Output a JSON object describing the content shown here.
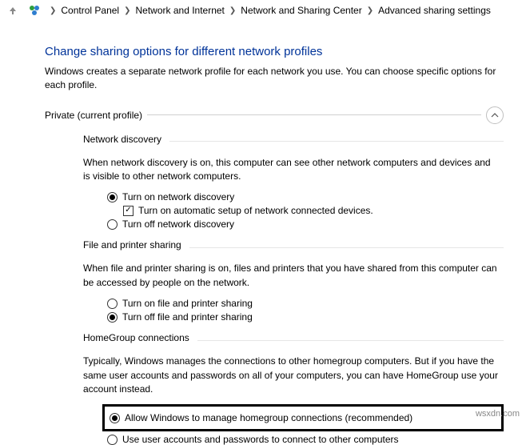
{
  "breadcrumb": {
    "items": [
      "Control Panel",
      "Network and Internet",
      "Network and Sharing Center",
      "Advanced sharing settings"
    ]
  },
  "title": "Change sharing options for different network profiles",
  "subtitle": "Windows creates a separate network profile for each network you use. You can choose specific options for each profile.",
  "profile_label": "Private (current profile)",
  "sections": {
    "network_discovery": {
      "title": "Network discovery",
      "desc": "When network discovery is on, this computer can see other network computers and devices and is visible to other network computers.",
      "opt_on": "Turn on network discovery",
      "opt_auto": "Turn on automatic setup of network connected devices.",
      "opt_off": "Turn off network discovery"
    },
    "file_printer": {
      "title": "File and printer sharing",
      "desc": "When file and printer sharing is on, files and printers that you have shared from this computer can be accessed by people on the network.",
      "opt_on": "Turn on file and printer sharing",
      "opt_off": "Turn off file and printer sharing"
    },
    "homegroup": {
      "title": "HomeGroup connections",
      "desc": "Typically, Windows manages the connections to other homegroup computers. But if you have the same user accounts and passwords on all of your computers, you can have HomeGroup use your account instead.",
      "opt_allow": "Allow Windows to manage homegroup connections (recommended)",
      "opt_user": "Use user accounts and passwords to connect to other computers"
    }
  },
  "watermark": "wsxdn.com"
}
